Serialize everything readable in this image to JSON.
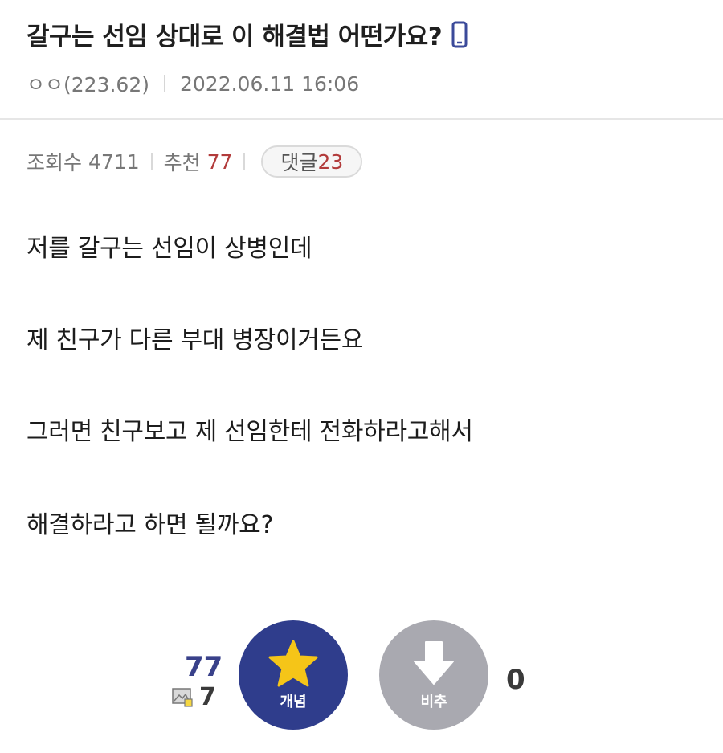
{
  "post": {
    "title": "갈구는 선임 상대로 이 해결법 어떤가요?",
    "author": "ㅇㅇ(223.62)",
    "date": "2022.06.11 16:06"
  },
  "stats": {
    "views_label": "조회수",
    "views": "4711",
    "recommend_label": "추천",
    "recommend": "77",
    "comments_label": "댓글",
    "comments": "23"
  },
  "content": {
    "lines": [
      "저를 갈구는 선임이 상병인데",
      "제 친구가 다른 부대 병장이거든요",
      "그러면 친구보고 제 선임한테 전화하라고해서",
      "해결하라고 하면 될까요?"
    ]
  },
  "vote": {
    "up_count": "77",
    "image_count": "7",
    "up_label": "개념",
    "down_label": "비추",
    "down_count": "0"
  },
  "icons": {
    "mobile": "mobile-phone-icon",
    "star": "star-icon",
    "down_arrow": "down-arrow-icon",
    "image": "image-icon"
  },
  "colors": {
    "accent_navy": "#2f3d8c",
    "star_yellow": "#f5c518",
    "red_count": "#b23b3b",
    "down_gray": "#a9a9b0"
  }
}
